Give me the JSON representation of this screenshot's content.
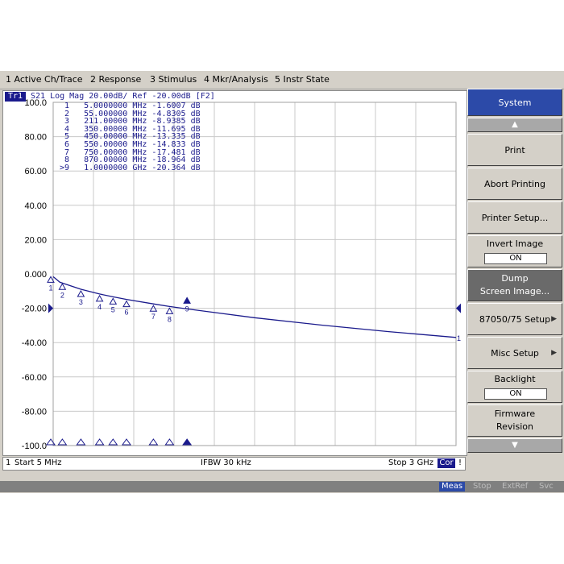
{
  "menu": [
    "1 Active Ch/Trace",
    "2 Response",
    "3 Stimulus",
    "4 Mkr/Analysis",
    "5 Instr State"
  ],
  "trace": {
    "badge": "Tr1",
    "header": "S21 Log Mag 20.00dB/ Ref -20.00dB [F2]"
  },
  "markers": [
    {
      "id": "1",
      "freq": "5.0000000 MHz",
      "value": "-1.6007 dB"
    },
    {
      "id": "2",
      "freq": "55.000000 MHz",
      "value": "-4.8305 dB"
    },
    {
      "id": "3",
      "freq": "211.00000 MHz",
      "value": "-8.9385 dB"
    },
    {
      "id": "4",
      "freq": "350.00000 MHz",
      "value": "-11.695 dB"
    },
    {
      "id": "5",
      "freq": "450.00000 MHz",
      "value": "-13.335 dB"
    },
    {
      "id": "6",
      "freq": "550.00000 MHz",
      "value": "-14.833 dB"
    },
    {
      "id": "7",
      "freq": "750.00000 MHz",
      "value": "-17.481 dB"
    },
    {
      "id": "8",
      "freq": "870.00000 MHz",
      "value": "-18.964 dB"
    },
    {
      "id": ">9",
      "freq": "1.0000000 GHz",
      "value": "-20.364 dB"
    }
  ],
  "chart_data": {
    "type": "line",
    "ylim": [
      -100,
      100
    ],
    "xlim_mhz": [
      5,
      3000
    ],
    "grid": true,
    "reference_level_db": -20,
    "y_ticks": [
      "100.0",
      "80.00",
      "60.00",
      "40.00",
      "20.00",
      "0.000",
      "-20.00",
      "-40.00",
      "-60.00",
      "-80.00",
      "-100.0"
    ],
    "series": [
      {
        "x_mhz": [
          5,
          55,
          211,
          350,
          450,
          550,
          750,
          870,
          1000,
          1500,
          2000,
          2500,
          3000
        ],
        "y_db": [
          -1.6007,
          -4.8305,
          -8.9385,
          -11.695,
          -13.335,
          -14.833,
          -17.481,
          -18.964,
          -20.364,
          -25.5,
          -29.8,
          -33.6,
          -37.0
        ]
      }
    ],
    "marker_labels": [
      "1",
      "2",
      "3",
      "4",
      "5",
      "6",
      "7",
      "8",
      "9"
    ],
    "end_label": "1",
    "color": "#1a1a8c"
  },
  "status": {
    "channel": "1",
    "start": "Start 5 MHz",
    "ifbw": "IFBW 30 kHz",
    "stop": "Stop 3 GHz",
    "cor": "Cor",
    "extra": "!"
  },
  "indicators": [
    {
      "label": "Meas",
      "active": true
    },
    {
      "label": "Stop",
      "active": false
    },
    {
      "label": "ExtRef",
      "active": false
    },
    {
      "label": "Svc",
      "active": false
    }
  ],
  "softkeys": {
    "title": "System",
    "print": "Print",
    "abort_printing": "Abort Printing",
    "printer_setup": "Printer Setup...",
    "invert_image": "Invert Image",
    "invert_image_state": "ON",
    "dump_line1": "Dump",
    "dump_line2": "Screen Image...",
    "setup_8705075": "87050/75 Setup",
    "misc_setup": "Misc Setup",
    "backlight": "Backlight",
    "backlight_state": "ON",
    "firmware_line1": "Firmware",
    "firmware_line2": "Revision"
  },
  "colors": {
    "trace": "#1a1a8c",
    "grid": "#c8c8c8",
    "softkey_title": "#2c4aa8",
    "panel": "#d4d0c8"
  }
}
